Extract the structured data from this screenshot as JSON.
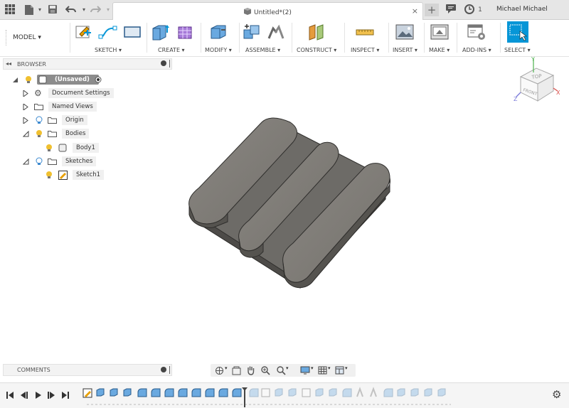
{
  "titlebar": {
    "doc_title": "Untitled*(2)",
    "close_tab": "×",
    "new_tab": "+",
    "job_count": "1",
    "user": "Michael Michael"
  },
  "ribbon": {
    "mode": "MODEL ▾",
    "groups": [
      "SKETCH ▾",
      "CREATE ▾",
      "MODIFY ▾",
      "ASSEMBLE ▾",
      "CONSTRUCT ▾",
      "INSPECT ▾",
      "INSERT ▾",
      "MAKE ▾",
      "ADD-INS ▾",
      "SELECT ▾"
    ]
  },
  "browser": {
    "title": "BROWSER",
    "root": "(Unsaved)",
    "items": [
      "Document Settings",
      "Named Views",
      "Origin",
      "Bodies",
      "Body1",
      "Sketches",
      "Sketch1"
    ]
  },
  "viewcube": {
    "top": "TOP",
    "front": "FRONT",
    "axes": [
      "Y",
      "Z",
      "X"
    ]
  },
  "comments": {
    "title": "COMMENTS"
  },
  "colors": {
    "accent": "#0696d7",
    "body": "#7c7a75",
    "body_dark": "#5e5c58"
  }
}
